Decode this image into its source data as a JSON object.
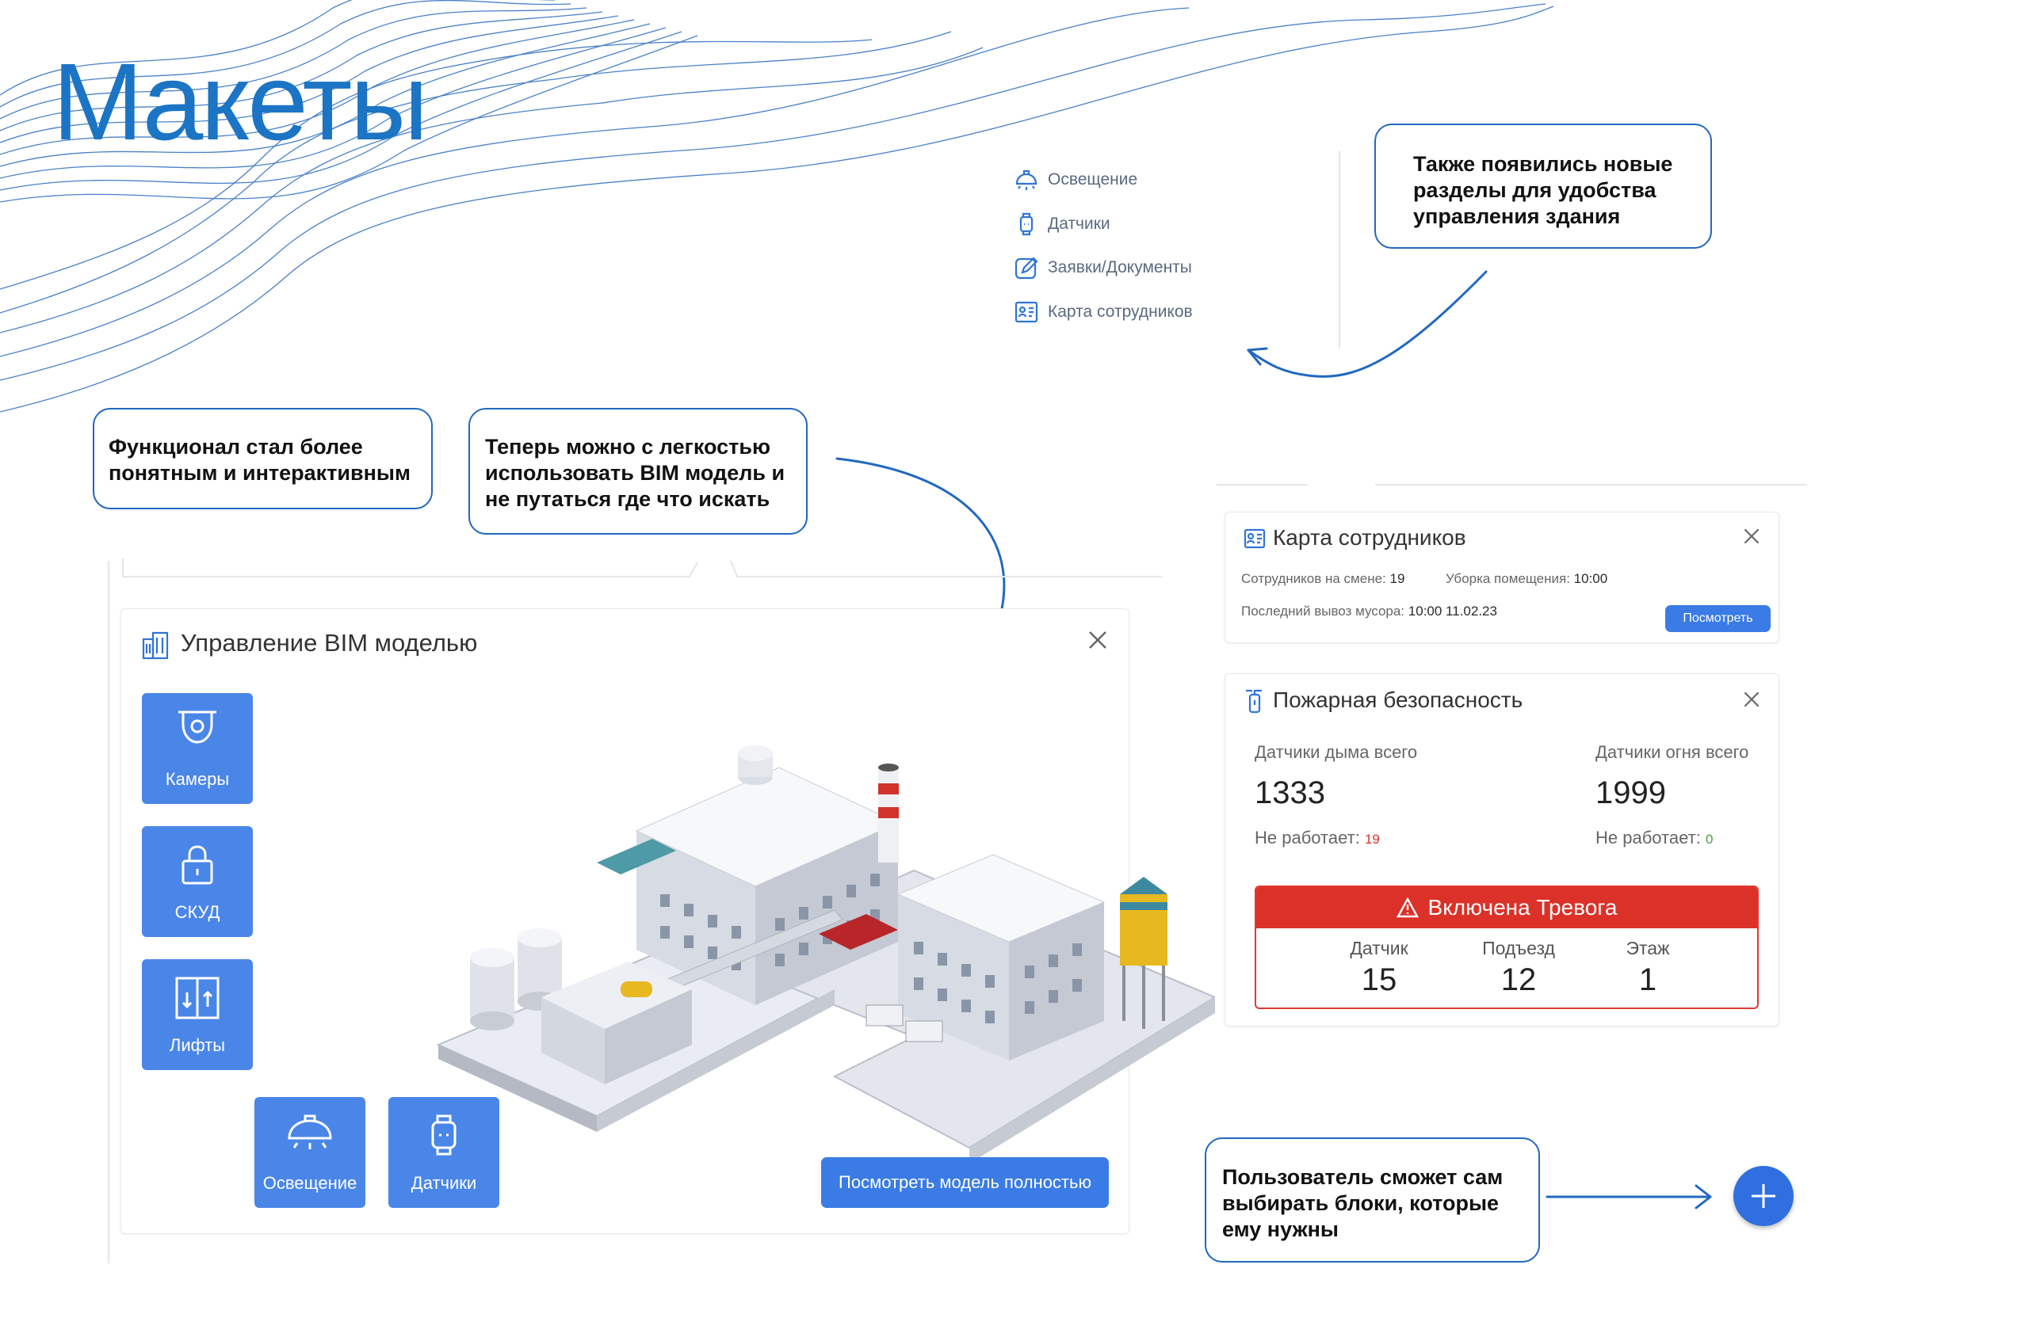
{
  "page": {
    "title": "Макеты"
  },
  "colors": {
    "accent": "#1c74c4",
    "button": "#3a7be5",
    "tile": "#4a86e8",
    "alarm": "#dc3128",
    "ok": "#44a23d"
  },
  "callouts": {
    "new_sections": "Также появились новые\nразделы для удобства\nуправления здания",
    "functionality": "Функционал стал более\nпонятным и интерактивным",
    "bim": "Теперь можно с легкостью\nиспользовать BIM модель и\nне путаться где что искать",
    "blocks": "Пользователь сможет сам\nвыбирать блоки, которые\nему нужны"
  },
  "side_nav": {
    "items": [
      {
        "label": "Освещение",
        "icon": "lamp-icon"
      },
      {
        "label": "Датчики",
        "icon": "sensor-icon"
      },
      {
        "label": "Заявки/Документы",
        "icon": "edit-icon"
      },
      {
        "label": "Карта сотрудников",
        "icon": "staff-map-icon"
      }
    ]
  },
  "bim_card": {
    "title": "Управление BIM моделью",
    "tiles": [
      {
        "label": "Камеры",
        "icon": "camera-icon"
      },
      {
        "label": "СКУД",
        "icon": "lock-icon"
      },
      {
        "label": "Лифты",
        "icon": "elevator-icon"
      },
      {
        "label": "Освещение",
        "icon": "lamp-icon"
      },
      {
        "label": "Датчики",
        "icon": "sensor-icon"
      }
    ],
    "button": "Посмотреть модель полностью"
  },
  "staff_card": {
    "title": "Карта сотрудников",
    "on_shift_label": "Сотрудников на смене:",
    "on_shift_value": "19",
    "cleaning_label": "Уборка помещения:",
    "cleaning_value": "10:00",
    "garbage_label": "Последний вывоз мусора:",
    "garbage_value": "10:00 11.02.23",
    "button": "Посмотреть"
  },
  "fire_card": {
    "title": "Пожарная безопасность",
    "smoke_label": "Датчики дыма всего",
    "smoke_value": "1333",
    "smoke_broken_label": "Не работает:",
    "smoke_broken_value": "19",
    "fire_label": "Датчики огня всего",
    "fire_value": "1999",
    "fire_broken_label": "Не работает:",
    "fire_broken_value": "0",
    "alarm": {
      "title": "Включена Тревога",
      "sensor_label": "Датчик",
      "sensor_value": "15",
      "entrance_label": "Подъезд",
      "entrance_value": "12",
      "floor_label": "Этаж",
      "floor_value": "1"
    }
  },
  "fab": {
    "icon": "plus-icon"
  }
}
